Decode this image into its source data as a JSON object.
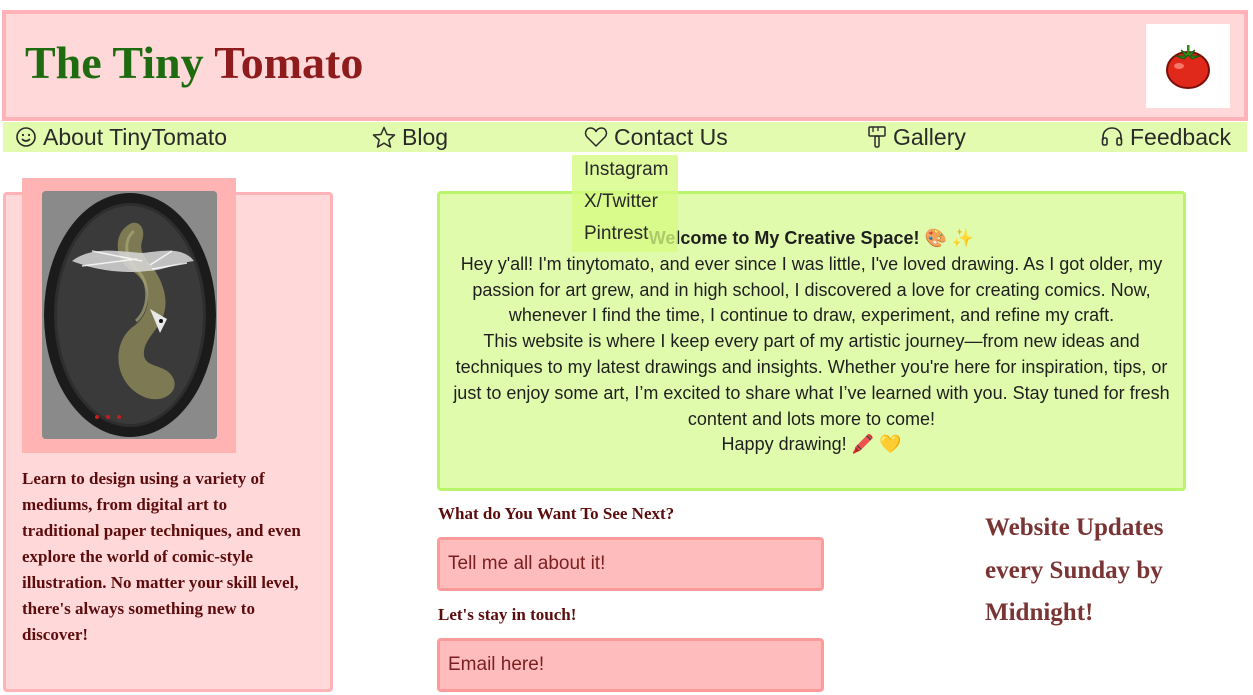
{
  "header": {
    "title_part1": "The Tiny",
    "title_part2": "Tomato",
    "logo_icon": "tomato-icon"
  },
  "nav": {
    "items": [
      {
        "label": "About TinyTomato",
        "icon": "smiley-icon"
      },
      {
        "label": "Blog",
        "icon": "star-icon"
      },
      {
        "label": "Contact Us",
        "icon": "heart-icon"
      },
      {
        "label": "Gallery",
        "icon": "paintbrush-icon"
      },
      {
        "label": "Feedback",
        "icon": "headphones-icon"
      }
    ]
  },
  "dropdown": {
    "items": [
      "Instagram",
      "X/Twitter",
      "Pintrest"
    ]
  },
  "sidebar": {
    "image_icon": "portrait-frame-image",
    "text": "Learn to design using a variety of mediums, from digital art to traditional paper techniques, and even explore the world of comic-style illustration. No matter your skill level, there's always something new to discover!"
  },
  "welcome": {
    "title": "Welcome to My Creative Space! 🎨 ✨",
    "paragraph1": "Hey y'all! I'm tinytomato, and ever since I was little, I've loved drawing. As I got older, my passion for art grew, and in high school, I discovered a love for creating comics. Now, whenever I find the time, I continue to draw, experiment, and refine my craft.",
    "paragraph2": "This website is where I keep every part of my artistic journey—from new ideas and techniques to my latest drawings and insights. Whether you're here for inspiration, tips, or just to enjoy some art, I’m excited to share what I’ve learned with you. Stay tuned for fresh content and lots more to come!",
    "signoff": "Happy drawing! 🖍️ 💛"
  },
  "form": {
    "question_label": "What do You Want To See Next?",
    "question_placeholder": "Tell me all about it!",
    "contact_label": "Let's stay in touch!",
    "email_placeholder": "Email here!"
  },
  "updates": {
    "text": "Website Updates every Sunday by Midnight!"
  },
  "colors": {
    "header_bg": "#ffd9d9",
    "nav_bg": "#e2fbae",
    "title_green": "#1f6b10",
    "title_red": "#8f1c1c",
    "field_bg": "#ffbcbc",
    "welcome_bg": "#e1fbad"
  }
}
